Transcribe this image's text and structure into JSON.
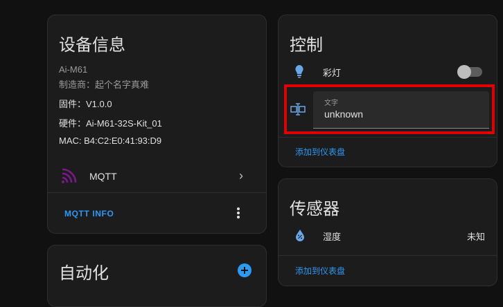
{
  "device_info": {
    "title": "设备信息",
    "model": "Ai-M61",
    "manufacturer": "制造商：起个名字真难",
    "firmware": "固件：V1.0.0",
    "hardware": "硬件：Ai-M61-32S-Kit_01",
    "mac": "MAC: B4:C2:E0:41:93:D9",
    "integration_label": "MQTT",
    "action_label": "MQTT INFO"
  },
  "automation": {
    "title": "自动化"
  },
  "control": {
    "title": "控制",
    "light_label": "彩灯",
    "light_on": false,
    "text_field_label": "文字",
    "text_field_value": "unknown",
    "add_to_dashboard": "添加到仪表盘"
  },
  "sensors": {
    "title": "传感器",
    "humidity_label": "湿度",
    "humidity_value": "未知",
    "add_to_dashboard": "添加到仪表盘"
  },
  "colors": {
    "accent": "#2b9af3",
    "highlight_border": "#e00000",
    "mqtt_icon": "#7a1a8a"
  }
}
